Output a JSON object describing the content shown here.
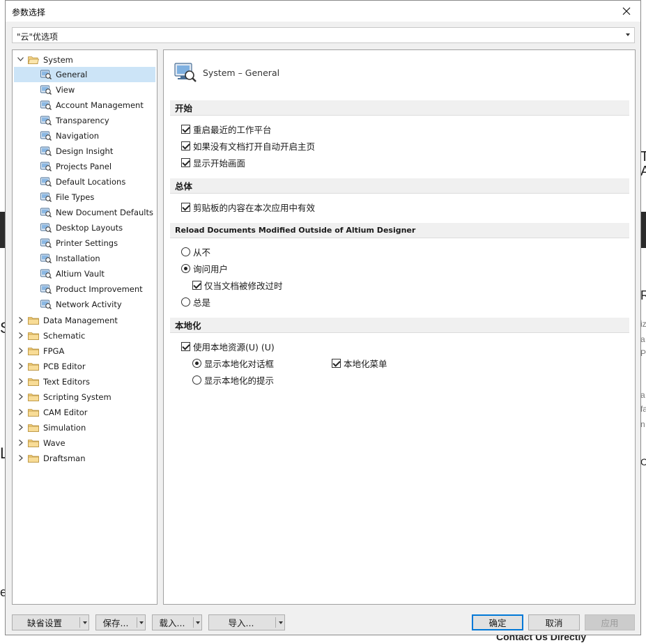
{
  "window": {
    "title": "参数选择"
  },
  "profile_select": {
    "value": "\"云\"优选项"
  },
  "tree": {
    "root": {
      "label": "System",
      "expanded": true
    },
    "system_children": [
      {
        "label": "General",
        "selected": true
      },
      {
        "label": "View"
      },
      {
        "label": "Account Management"
      },
      {
        "label": "Transparency"
      },
      {
        "label": "Navigation"
      },
      {
        "label": "Design Insight"
      },
      {
        "label": "Projects Panel"
      },
      {
        "label": "Default Locations"
      },
      {
        "label": "File Types"
      },
      {
        "label": "New Document Defaults"
      },
      {
        "label": "Desktop Layouts"
      },
      {
        "label": "Printer Settings"
      },
      {
        "label": "Installation"
      },
      {
        "label": "Altium Vault"
      },
      {
        "label": "Product Improvement"
      },
      {
        "label": "Network Activity"
      }
    ],
    "other_roots": [
      {
        "label": "Data Management"
      },
      {
        "label": "Schematic"
      },
      {
        "label": "FPGA"
      },
      {
        "label": "PCB Editor"
      },
      {
        "label": "Text Editors"
      },
      {
        "label": "Scripting System"
      },
      {
        "label": "CAM Editor"
      },
      {
        "label": "Simulation"
      },
      {
        "label": "Wave"
      },
      {
        "label": "Draftsman"
      }
    ]
  },
  "content": {
    "title": "System – General",
    "sections": {
      "start": "开始",
      "general": "总体",
      "reload": "Reload Documents Modified Outside of Altium Designer",
      "localization": "本地化"
    },
    "options": {
      "reopen_workspace": {
        "label": "重启最近的工作平台",
        "checked": true
      },
      "auto_home": {
        "label": "如果没有文档打开自动开启主页",
        "checked": true
      },
      "show_splash": {
        "label": "显示开始画面",
        "checked": true
      },
      "clipboard_session": {
        "label": "剪贴板的内容在本次应用中有效",
        "checked": true
      },
      "reload_never": {
        "label": "从不",
        "checked": false
      },
      "reload_ask": {
        "label": "询问用户",
        "checked": true
      },
      "only_if_modified": {
        "label": "仅当文档被修改过时",
        "checked": true
      },
      "reload_always": {
        "label": "总是",
        "checked": false
      },
      "use_local_resources": {
        "label": "使用本地资源(U) (U)",
        "checked": true
      },
      "show_localized_dialogs": {
        "label": "显示本地化对话框",
        "checked": true
      },
      "localized_menus": {
        "label": "本地化菜单",
        "checked": true
      },
      "show_localized_hints": {
        "label": "显示本地化的提示",
        "checked": false
      }
    }
  },
  "footer": {
    "defaults": "缺省设置",
    "save": "保存...",
    "load": "载入...",
    "import": "导入...",
    "ok": "确定",
    "cancel": "取消",
    "apply": "应用"
  },
  "background_fragments": [
    "T",
    "A",
    "R",
    "S",
    "L",
    "iz",
    "a",
    "P",
    "a",
    "fa",
    "n",
    "C",
    "e",
    "O",
    "ou",
    "ev",
    "Contact Us Directly"
  ],
  "colors": {
    "accent": "#0078d7",
    "selection": "#cce4f7",
    "section_bg": "#f0f0f0"
  }
}
